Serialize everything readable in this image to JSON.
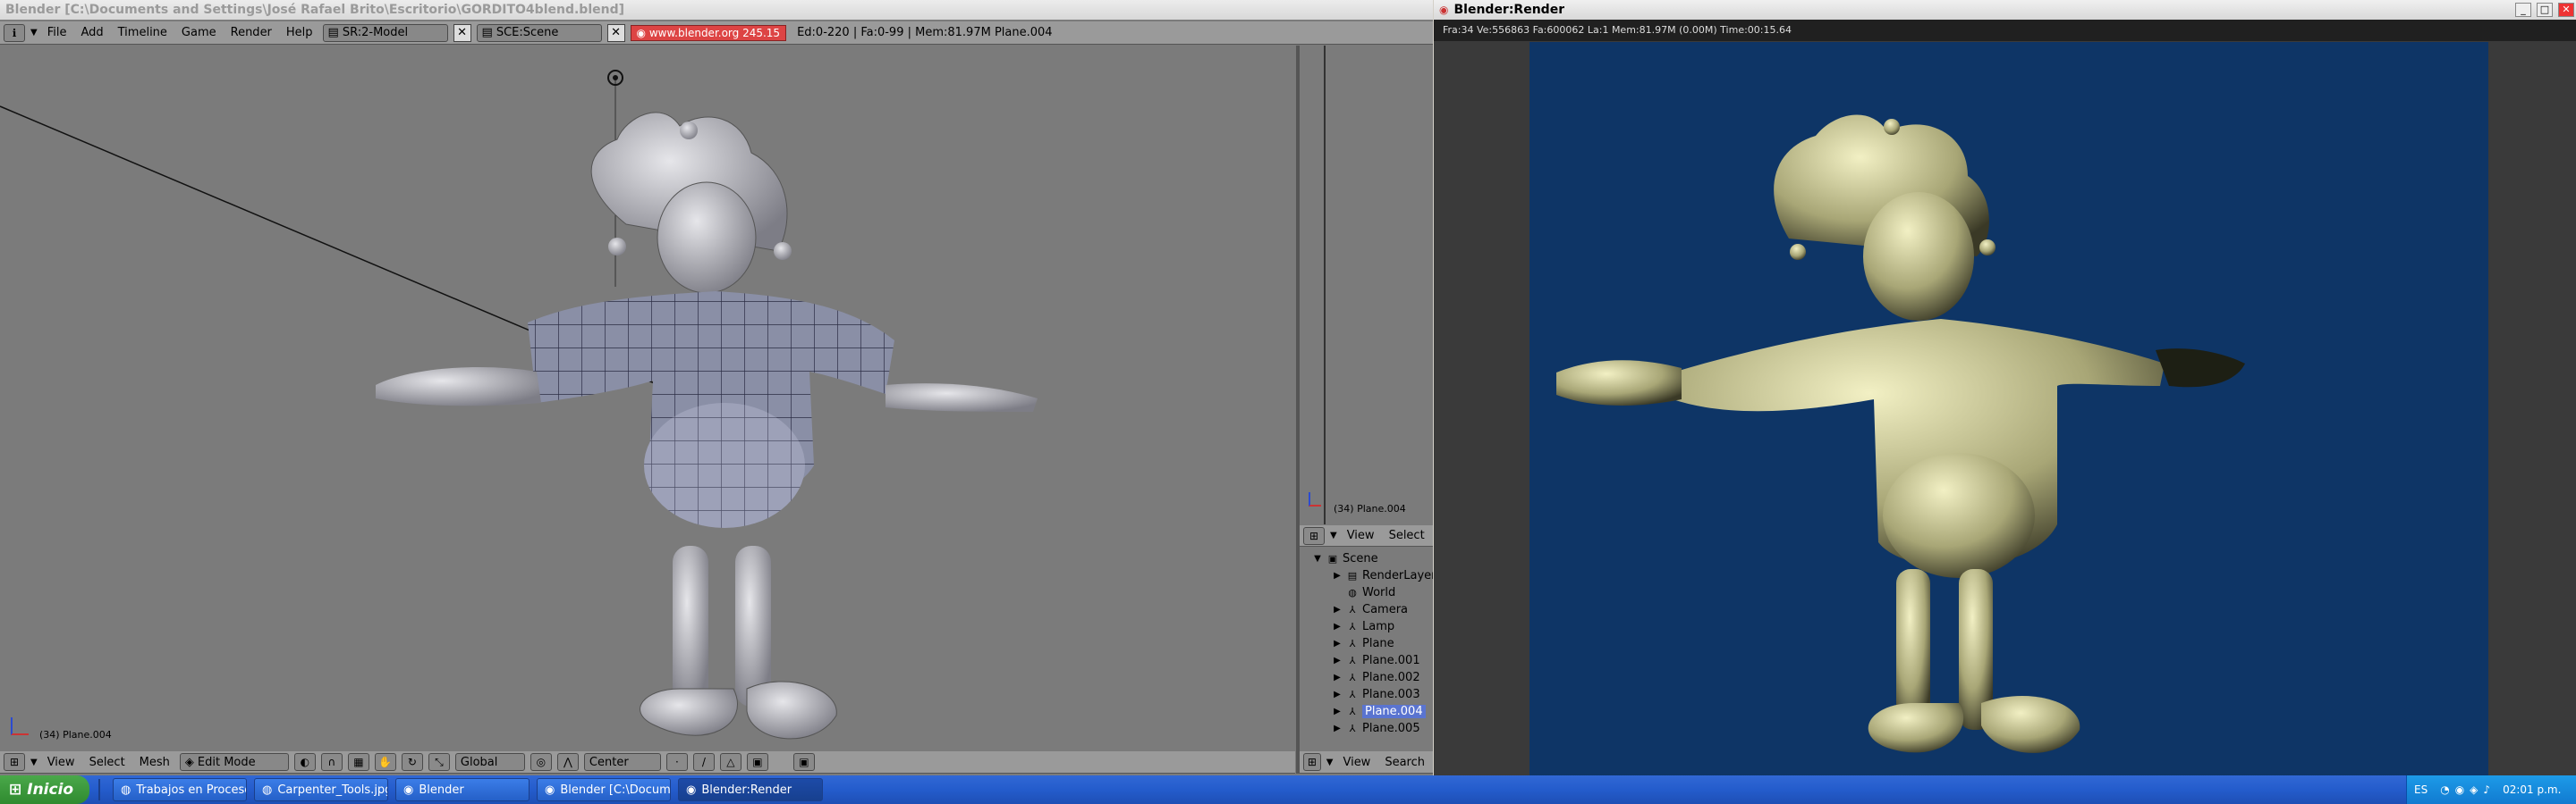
{
  "blender_window": {
    "title": "Blender [C:\\Documents and Settings\\José Rafael Brito\\Escritorio\\GORDITO4blend.blend]"
  },
  "menu": {
    "items": [
      "File",
      "Add",
      "Timeline",
      "Game",
      "Render",
      "Help"
    ],
    "screen_field": "SR:2-Model",
    "scene_field": "SCE:Scene",
    "url_text": "www.blender.org 245.15",
    "stats": "Ed:0-220 | Fa:0-99 | Mem:81.97M Plane.004"
  },
  "viewport": {
    "object_label": "(34) Plane.004",
    "header": {
      "view": "View",
      "select": "Select",
      "mesh": "Mesh",
      "mode": "Edit Mode",
      "orientation": "Global",
      "pivot": "Center"
    }
  },
  "timeline_panel": {
    "object_label": "(34) Plane.004"
  },
  "outliner": {
    "header_view": "View",
    "header_select": "Select",
    "footer_view": "View",
    "footer_search": "Search",
    "rows": [
      {
        "label": "Scene",
        "level": 0,
        "icon": "scene-icon",
        "expand": "▼"
      },
      {
        "label": "RenderLayers",
        "level": 1,
        "icon": "renderlayers-icon",
        "expand": "▶"
      },
      {
        "label": "World",
        "level": 1,
        "icon": "world-icon",
        "expand": ""
      },
      {
        "label": "Camera",
        "level": 1,
        "icon": "object-icon",
        "expand": "▶"
      },
      {
        "label": "Lamp",
        "level": 1,
        "icon": "object-icon",
        "expand": "▶"
      },
      {
        "label": "Plane",
        "level": 1,
        "icon": "object-icon",
        "expand": "▶"
      },
      {
        "label": "Plane.001",
        "level": 1,
        "icon": "object-icon",
        "expand": "▶"
      },
      {
        "label": "Plane.002",
        "level": 1,
        "icon": "object-icon",
        "expand": "▶"
      },
      {
        "label": "Plane.003",
        "level": 1,
        "icon": "object-icon",
        "expand": "▶"
      },
      {
        "label": "Plane.004",
        "level": 1,
        "icon": "object-icon",
        "expand": "▶",
        "selected": true
      },
      {
        "label": "Plane.005",
        "level": 1,
        "icon": "object-icon",
        "expand": "▶"
      }
    ]
  },
  "render_window": {
    "title": "Blender:Render",
    "info": "Fra:34  Ve:556863 Fa:600062 La:1 Mem:81.97M (0.00M) Time:00:15.64",
    "bg_color": "#0e3566"
  },
  "taskbar": {
    "start_label": "Inicio",
    "tasks": [
      "Trabajos en Proceso ...",
      "Carpenter_Tools.jpg ...",
      "Blender",
      "Blender [C:\\Documen...",
      "Blender:Render"
    ],
    "lang": "ES",
    "clock": "02:01 p.m."
  },
  "colors": {
    "viewport_bg": "#7b7b7b",
    "selected_row": "#5a74d0"
  }
}
